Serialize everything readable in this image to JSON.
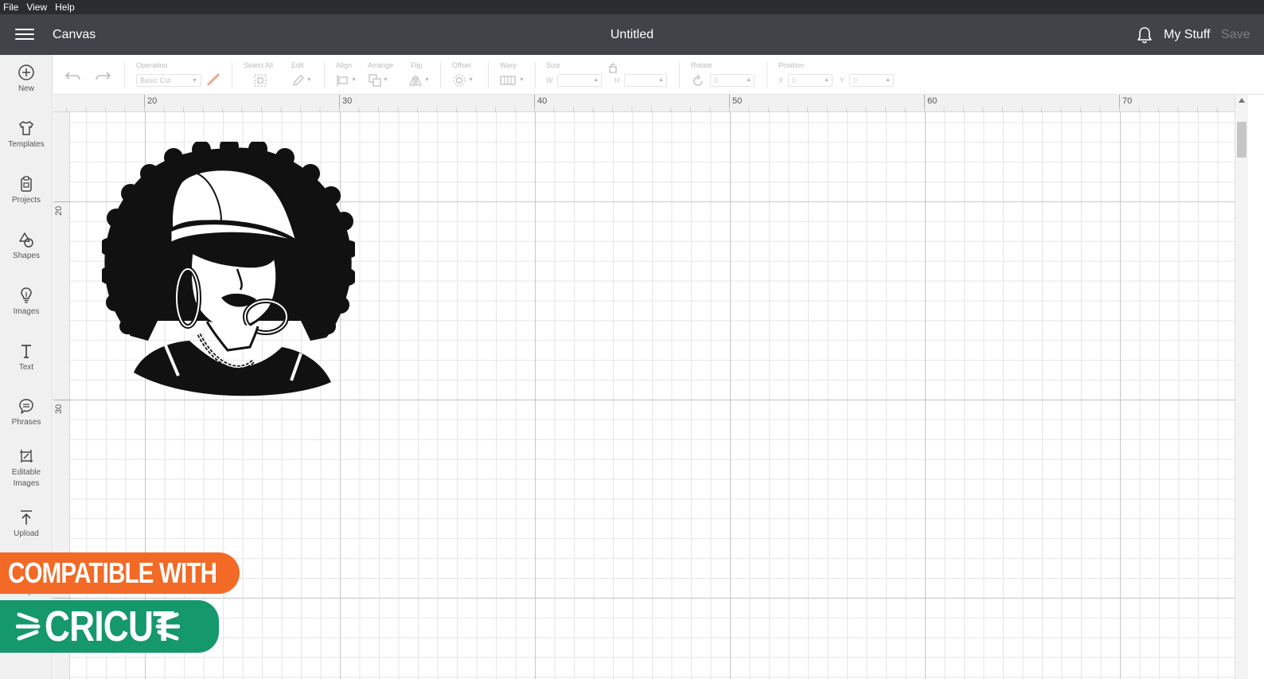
{
  "menubar": {
    "items": [
      "File",
      "View",
      "Help"
    ]
  },
  "header": {
    "app_title": "Canvas",
    "doc_title": "Untitled",
    "my_stuff": "My Stuff",
    "save": "Save"
  },
  "sidebar": {
    "items": [
      {
        "label": "New",
        "icon": "plus-circle-icon"
      },
      {
        "label": "Templates",
        "icon": "tshirt-icon"
      },
      {
        "label": "Projects",
        "icon": "clipboard-icon"
      },
      {
        "label": "Shapes",
        "icon": "shapes-icon"
      },
      {
        "label": "Images",
        "icon": "lightbulb-icon"
      },
      {
        "label": "Text",
        "icon": "text-t-icon"
      },
      {
        "label": "Phrases",
        "icon": "speech-bubble-icon"
      },
      {
        "label": "Editable Images",
        "icon": "edit-image-icon"
      },
      {
        "label": "Upload",
        "icon": "upload-icon"
      },
      {
        "label": "Monogram",
        "icon": "monogram-icon"
      }
    ]
  },
  "toolbar": {
    "operation_label": "Operation",
    "operation_value": "Basic Cut",
    "select_all_label": "Select All",
    "edit_label": "Edit",
    "align_label": "Align",
    "arrange_label": "Arrange",
    "flip_label": "Flip",
    "offset_label": "Offset",
    "warp_label": "Warp",
    "size_label": "Size",
    "w_label": "W",
    "h_label": "H",
    "rotate_label": "Rotate",
    "rotate_value": "0",
    "position_label": "Position",
    "x_label": "X",
    "x_value": "0",
    "y_label": "Y",
    "y_value": "0"
  },
  "rulers": {
    "top": [
      "20",
      "30",
      "40",
      "50",
      "60",
      "70"
    ],
    "left": [
      "20",
      "30"
    ]
  },
  "badges": {
    "compatible": "COMPATIBLE WITH",
    "brand": "CRICUT",
    "compatible_color": "#f26a26",
    "brand_color": "#15986b"
  },
  "colors": {
    "menubar": "#2b2c30",
    "header": "#414348",
    "sidebar": "#f0f0f0"
  }
}
